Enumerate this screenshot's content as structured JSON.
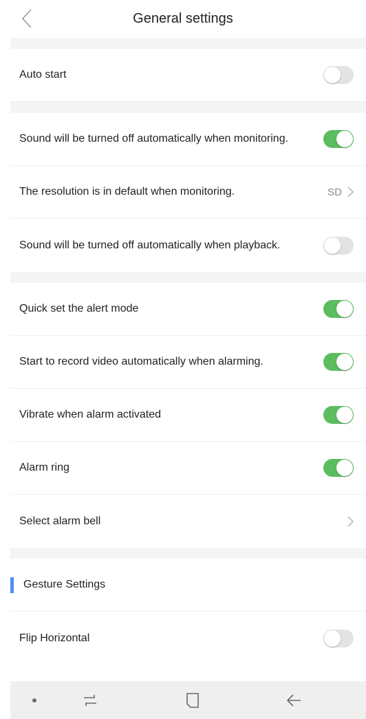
{
  "header": {
    "title": "General settings"
  },
  "settings": {
    "auto_start": {
      "label": "Auto start",
      "enabled": false
    },
    "sound_off_monitoring": {
      "label": "Sound will be turned off automatically when monitoring.",
      "enabled": true
    },
    "resolution_default": {
      "label": "The resolution is in default when monitoring.",
      "value": "SD"
    },
    "sound_off_playback": {
      "label": "Sound will be turned off automatically when playback.",
      "enabled": false
    },
    "quick_alert_mode": {
      "label": "Quick set the alert mode",
      "enabled": true
    },
    "record_on_alarm": {
      "label": "Start to record video automatically when alarming.",
      "enabled": true
    },
    "vibrate_on_alarm": {
      "label": "Vibrate when alarm activated",
      "enabled": true
    },
    "alarm_ring": {
      "label": "Alarm ring",
      "enabled": true
    },
    "select_alarm_bell": {
      "label": "Select alarm bell"
    }
  },
  "gesture_section": {
    "title": "Gesture Settings",
    "flip_horizontal": {
      "label": "Flip Horizontal",
      "enabled": false
    }
  },
  "colors": {
    "toggle_on": "#5cbd5f",
    "toggle_off": "#e3e3e3",
    "section_accent": "#4f8ff3"
  },
  "nav_bar": {
    "icons": [
      "dot-icon",
      "recent-apps-icon",
      "home-icon",
      "back-arrow-icon"
    ]
  }
}
